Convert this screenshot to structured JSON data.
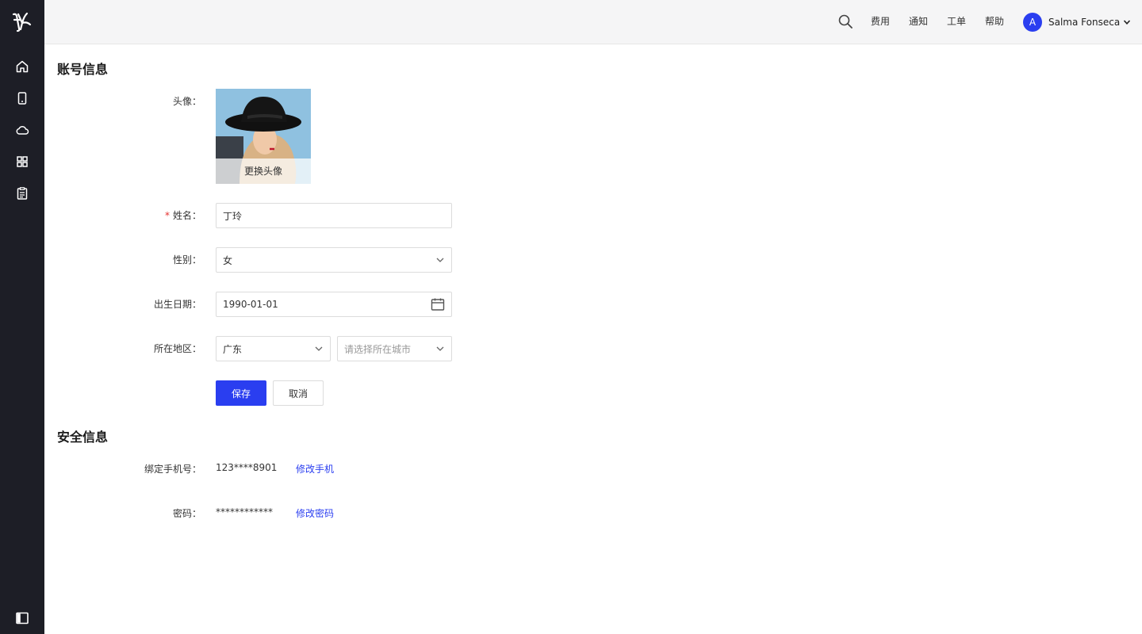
{
  "topbar": {
    "links": [
      "费用",
      "通知",
      "工单",
      "帮助"
    ],
    "user": {
      "initial": "A",
      "name": "Salma Fonseca"
    }
  },
  "sidebar": {
    "items": [
      "home-icon",
      "mobile-icon",
      "cloud-icon",
      "apps-grid-icon",
      "clipboard-icon"
    ]
  },
  "account": {
    "title": "账号信息",
    "avatar_label": "头像：",
    "avatar_change": "更换头像",
    "name_label": "姓名：",
    "name_required_mark": "*",
    "name_value": "丁玲",
    "gender_label": "性别：",
    "gender_value": "女",
    "birth_label": "出生日期：",
    "birth_value": "1990-01-01",
    "region_label": "所在地区：",
    "province_value": "广东",
    "city_placeholder": "请选择所在城市",
    "save_label": "保存",
    "cancel_label": "取消"
  },
  "security": {
    "title": "安全信息",
    "phone_label": "绑定手机号：",
    "phone_value": "123****8901",
    "phone_link": "修改手机",
    "password_label": "密码：",
    "password_value": "************",
    "password_link": "修改密码"
  },
  "colors": {
    "primary": "#2a3ef0",
    "sidebar": "#1d1e26",
    "required": "#e5312f"
  }
}
